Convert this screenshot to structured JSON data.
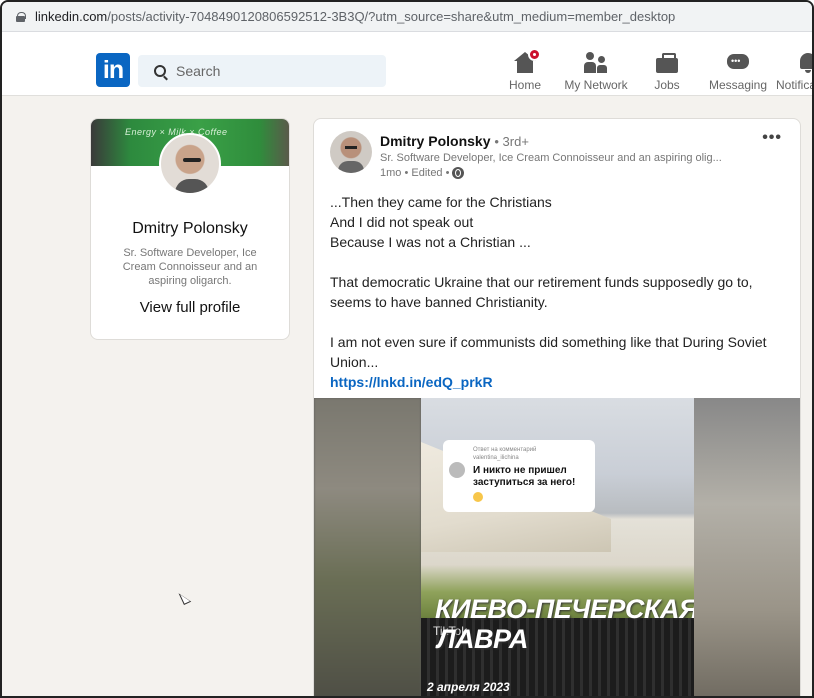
{
  "browser": {
    "url_domain": "linkedin.com",
    "url_rest": "/posts/activity-7048490120806592512-3B3Q/?utm_source=share&utm_medium=member_desktop"
  },
  "nav": {
    "logo": "in",
    "search_placeholder": "Search",
    "items": [
      {
        "label": "Home",
        "icon": "home-icon"
      },
      {
        "label": "My Network",
        "icon": "network-icon"
      },
      {
        "label": "Jobs",
        "icon": "jobs-icon"
      },
      {
        "label": "Messaging",
        "icon": "messaging-icon"
      },
      {
        "label": "Notifica",
        "icon": "notifications-icon"
      }
    ]
  },
  "profile": {
    "cover_text": "Energy × Milk × Coffee",
    "name": "Dmitry Polonsky",
    "title": "Sr. Software Developer, Ice Cream Connoisseur and an aspiring oligarch.",
    "link": "View full profile"
  },
  "post": {
    "author": "Dmitry Polonsky",
    "degree": "• 3rd+",
    "headline": "Sr. Software Developer, Ice Cream Connoisseur and an aspiring olig...",
    "meta": "1mo • Edited •",
    "more": "•••",
    "lines": [
      "...Then they came for the Christians",
      "And I did not speak out",
      "Because I was not a Christian ..."
    ],
    "para2": "That democratic Ukraine that our retirement funds supposedly go to, seems to have banned Christianity.",
    "para3": "I am not even sure if communists did something like that During Soviet Union...",
    "link": "https://lnkd.in/edQ_prkR"
  },
  "video": {
    "comment_reply": "Ответ на комментарий",
    "comment_user": "valentina_ilichina",
    "comment_text": "И никто не пришел заступиться за него!",
    "title_line1": "КИЕВО-ПЕЧЕРСКАЯ",
    "title_line2": "ЛАВРА",
    "watermark": "TikTok",
    "date": "2 апреля 2023"
  }
}
